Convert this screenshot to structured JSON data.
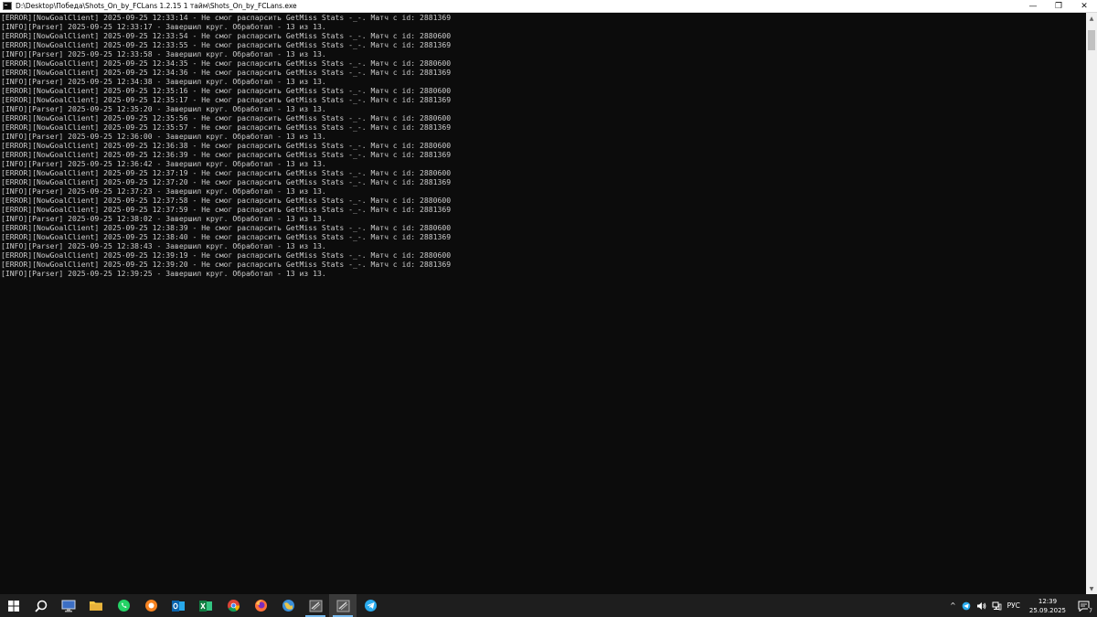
{
  "window": {
    "title": "D:\\Desktop\\Победа\\Shots_On_by_FCLans 1.2.15 1 тайм\\Shots_On_by_FCLans.exe",
    "minimize_glyph": "—",
    "maximize_glyph": "❐",
    "close_glyph": "✕"
  },
  "console": {
    "lines": [
      "[ERROR][NowGoalClient] 2025-09-25 12:33:14 - Не смог распарсить GetMiss Stats -_-. Матч с id: 2881369",
      "[INFO][Parser] 2025-09-25 12:33:17 - Завершил круг. Обработал - 13 из 13.",
      "[ERROR][NowGoalClient] 2025-09-25 12:33:54 - Не смог распарсить GetMiss Stats -_-. Матч с id: 2880600",
      "[ERROR][NowGoalClient] 2025-09-25 12:33:55 - Не смог распарсить GetMiss Stats -_-. Матч с id: 2881369",
      "[INFO][Parser] 2025-09-25 12:33:58 - Завершил круг. Обработал - 13 из 13.",
      "[ERROR][NowGoalClient] 2025-09-25 12:34:35 - Не смог распарсить GetMiss Stats -_-. Матч с id: 2880600",
      "[ERROR][NowGoalClient] 2025-09-25 12:34:36 - Не смог распарсить GetMiss Stats -_-. Матч с id: 2881369",
      "[INFO][Parser] 2025-09-25 12:34:38 - Завершил круг. Обработал - 13 из 13.",
      "[ERROR][NowGoalClient] 2025-09-25 12:35:16 - Не смог распарсить GetMiss Stats -_-. Матч с id: 2880600",
      "[ERROR][NowGoalClient] 2025-09-25 12:35:17 - Не смог распарсить GetMiss Stats -_-. Матч с id: 2881369",
      "[INFO][Parser] 2025-09-25 12:35:20 - Завершил круг. Обработал - 13 из 13.",
      "[ERROR][NowGoalClient] 2025-09-25 12:35:56 - Не смог распарсить GetMiss Stats -_-. Матч с id: 2880600",
      "[ERROR][NowGoalClient] 2025-09-25 12:35:57 - Не смог распарсить GetMiss Stats -_-. Матч с id: 2881369",
      "[INFO][Parser] 2025-09-25 12:36:00 - Завершил круг. Обработал - 13 из 13.",
      "[ERROR][NowGoalClient] 2025-09-25 12:36:38 - Не смог распарсить GetMiss Stats -_-. Матч с id: 2880600",
      "[ERROR][NowGoalClient] 2025-09-25 12:36:39 - Не смог распарсить GetMiss Stats -_-. Матч с id: 2881369",
      "[INFO][Parser] 2025-09-25 12:36:42 - Завершил круг. Обработал - 13 из 13.",
      "[ERROR][NowGoalClient] 2025-09-25 12:37:19 - Не смог распарсить GetMiss Stats -_-. Матч с id: 2880600",
      "[ERROR][NowGoalClient] 2025-09-25 12:37:20 - Не смог распарсить GetMiss Stats -_-. Матч с id: 2881369",
      "[INFO][Parser] 2025-09-25 12:37:23 - Завершил круг. Обработал - 13 из 13.",
      "[ERROR][NowGoalClient] 2025-09-25 12:37:58 - Не смог распарсить GetMiss Stats -_-. Матч с id: 2880600",
      "[ERROR][NowGoalClient] 2025-09-25 12:37:59 - Не смог распарсить GetMiss Stats -_-. Матч с id: 2881369",
      "[INFO][Parser] 2025-09-25 12:38:02 - Завершил круг. Обработал - 13 из 13.",
      "[ERROR][NowGoalClient] 2025-09-25 12:38:39 - Не смог распарсить GetMiss Stats -_-. Матч с id: 2880600",
      "[ERROR][NowGoalClient] 2025-09-25 12:38:40 - Не смог распарсить GetMiss Stats -_-. Матч с id: 2881369",
      "[INFO][Parser] 2025-09-25 12:38:43 - Завершил круг. Обработал - 13 из 13.",
      "[ERROR][NowGoalClient] 2025-09-25 12:39:19 - Не смог распарсить GetMiss Stats -_-. Матч с id: 2880600",
      "[ERROR][NowGoalClient] 2025-09-25 12:39:20 - Не смог распарсить GetMiss Stats -_-. Матч с id: 2881369",
      "[INFO][Parser] 2025-09-25 12:39:25 - Завершил круг. Обработал - 13 из 13."
    ],
    "text_color": "#cccccc",
    "background": "#0c0c0c"
  },
  "taskbar": {
    "background": "#1e1e1e",
    "apps": [
      {
        "icon": "windows-start-icon"
      },
      {
        "icon": "search-icon"
      },
      {
        "icon": "remote-desktop-icon"
      },
      {
        "icon": "file-explorer-icon"
      },
      {
        "icon": "whatsapp-icon"
      },
      {
        "icon": "orange-app-icon"
      },
      {
        "icon": "outlook-icon"
      },
      {
        "icon": "excel-icon"
      },
      {
        "icon": "chrome-icon"
      },
      {
        "icon": "firefox-icon"
      },
      {
        "icon": "globe-app-icon"
      },
      {
        "icon": "console-app-icon"
      },
      {
        "icon": "console-app-active-icon"
      },
      {
        "icon": "telegram-icon"
      }
    ],
    "tray": {
      "chevron_glyph": "^",
      "language": "РУС",
      "time": "12:39",
      "date": "25.09.2025",
      "notification_count": "7"
    }
  }
}
